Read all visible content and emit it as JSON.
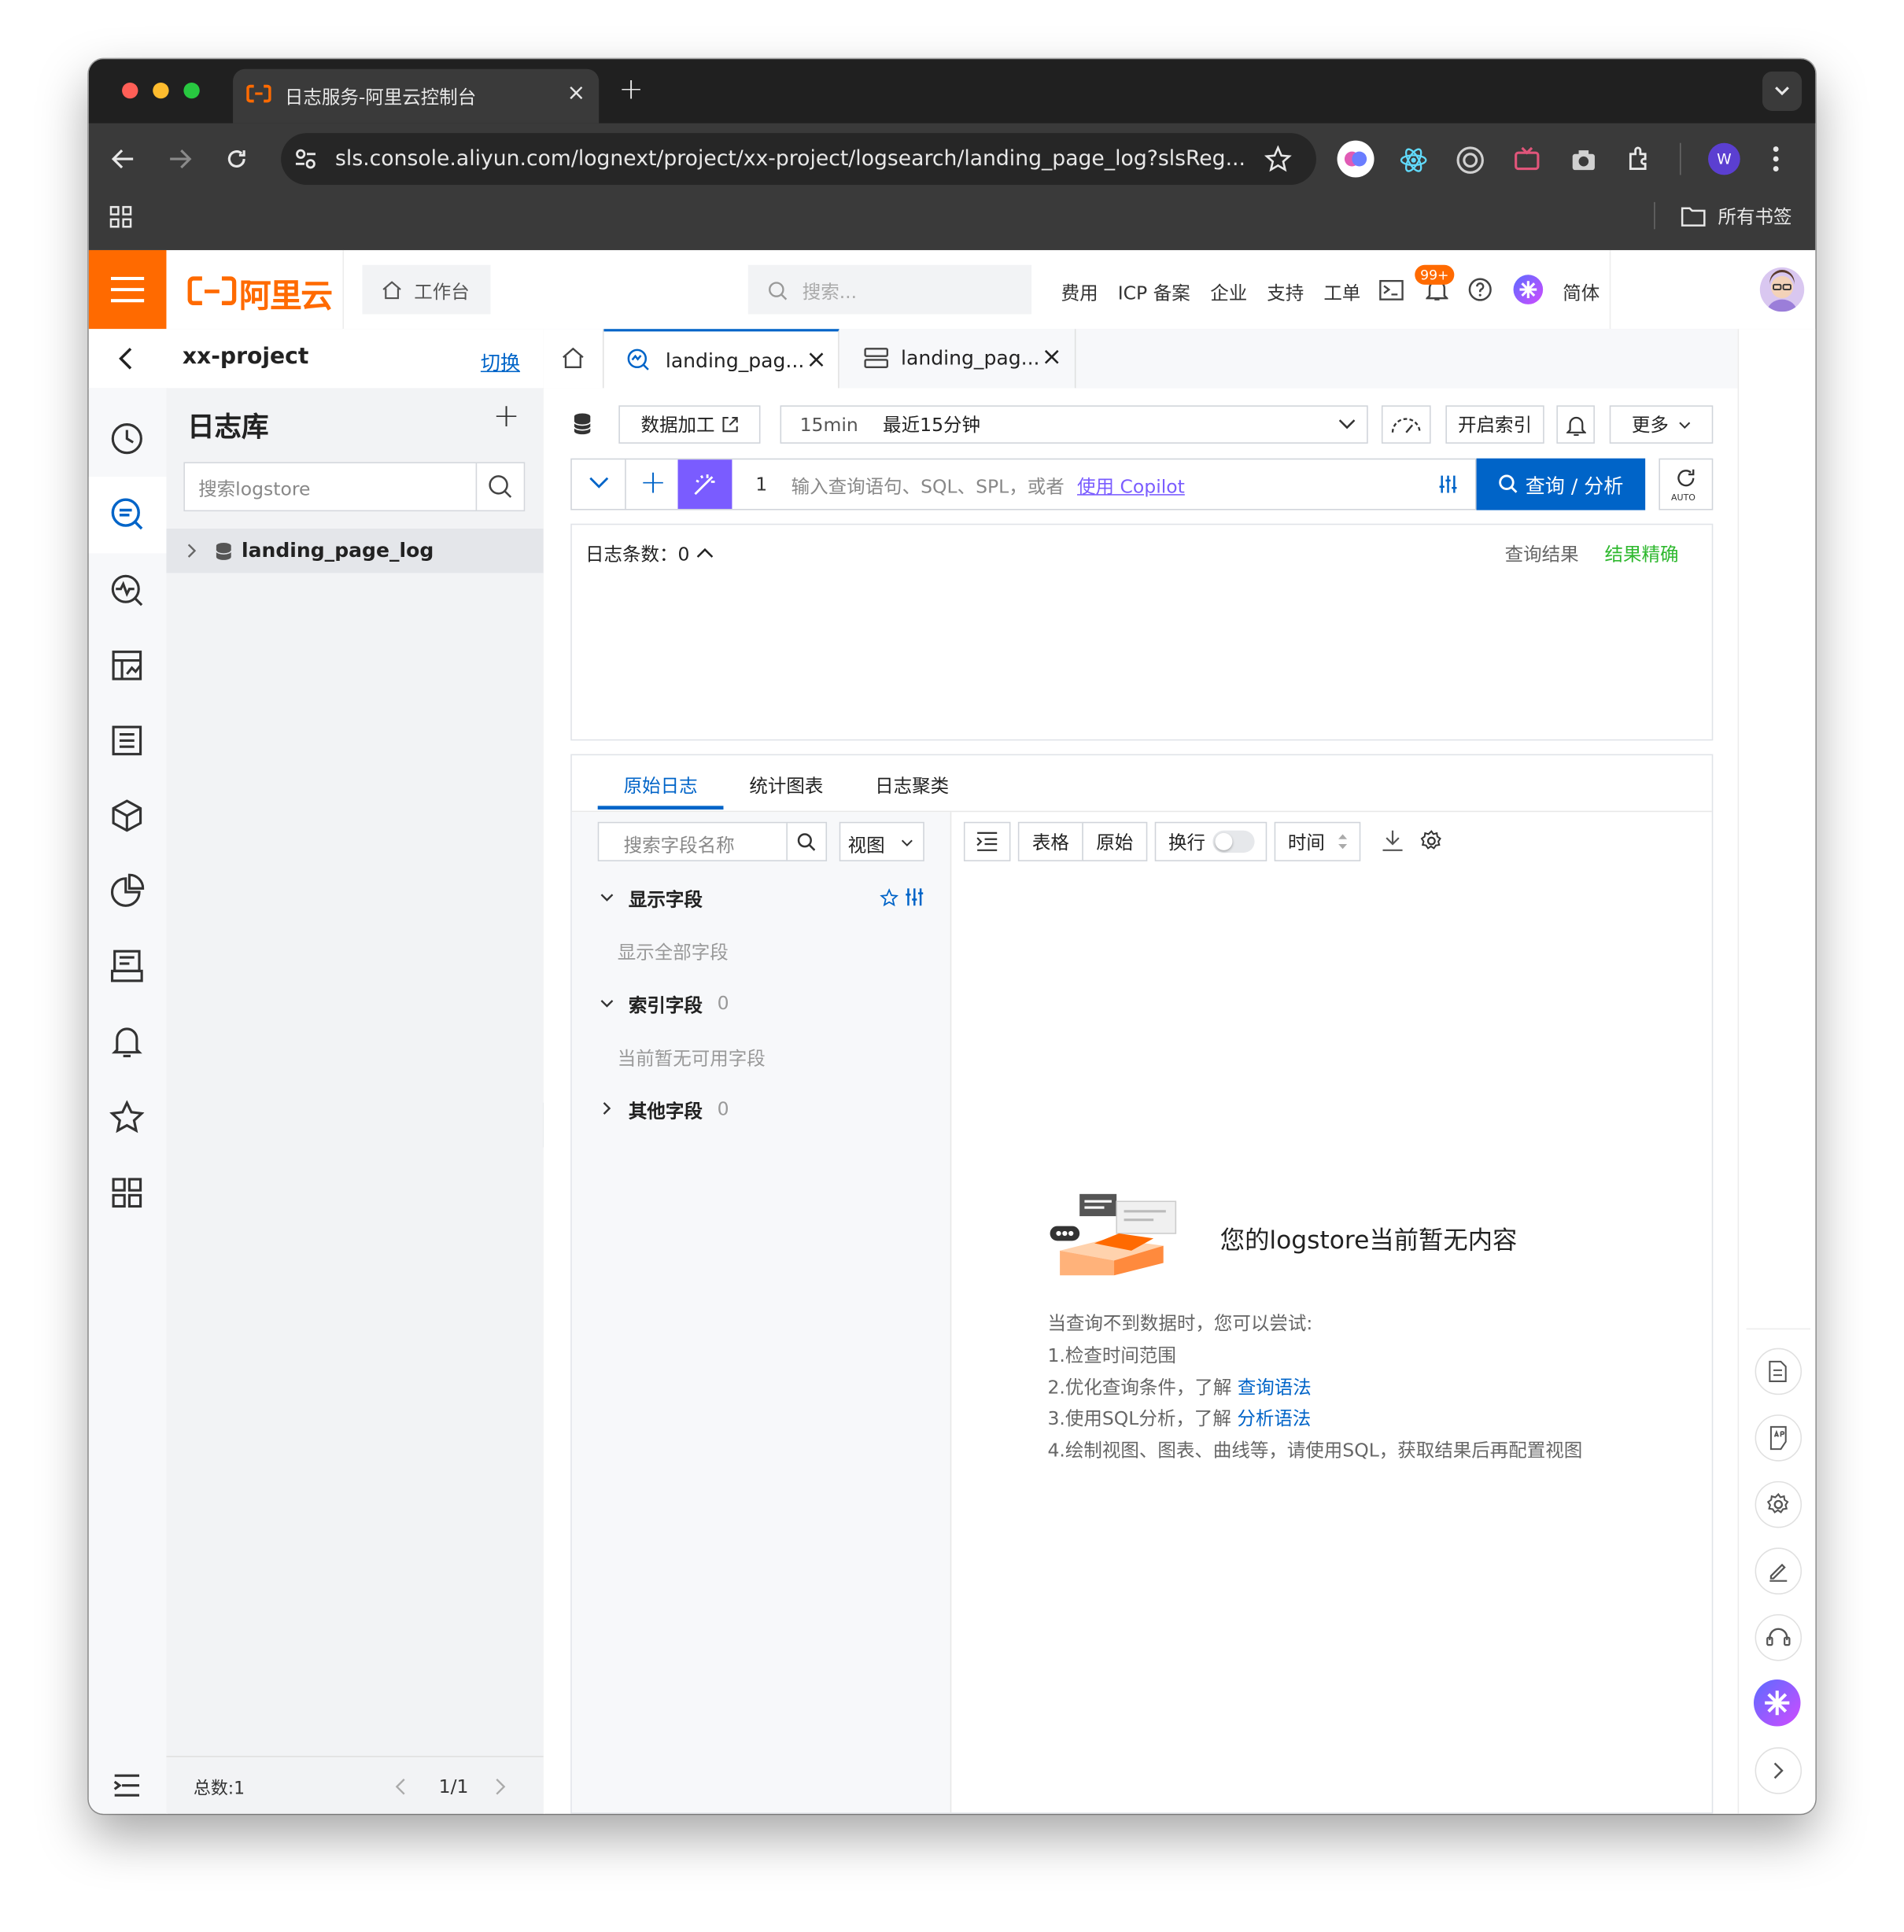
{
  "browser": {
    "tab1_title": "日志服务-阿里云控制台",
    "url": "sls.console.aliyun.com/lognext/project/xx-project/logsearch/landing_page_log?slsReg...",
    "bookmarks_label": "所有书签",
    "profile_initial": "W"
  },
  "topbar": {
    "brand": "阿里云",
    "workbench": "工作台",
    "search_placeholder": "搜索...",
    "links": [
      "费用",
      "ICP 备案",
      "企业",
      "支持",
      "工单"
    ],
    "badge": "99+",
    "lang": "简体"
  },
  "project": {
    "name": "xx-project",
    "switch": "切换"
  },
  "tabs": [
    {
      "label": "landing_pag..."
    },
    {
      "label": "landing_pag..."
    }
  ],
  "logstore_panel": {
    "title": "日志库",
    "search_placeholder": "搜索logstore",
    "item": "landing_page_log",
    "total": "总数:1",
    "page": "1/1"
  },
  "toolbar": {
    "data_process": "数据加工",
    "time_short": "15min",
    "time_label": "最近15分钟",
    "enable_index": "开启索引",
    "more": "更多"
  },
  "query": {
    "line_no": "1",
    "placeholder": "输入查询语句、SQL、SPL，或者",
    "copilot": "使用 Copilot",
    "search_btn": "查询 / 分析",
    "auto": "AUTO"
  },
  "histogram": {
    "count_label": "日志条数：0",
    "result_label": "查询结果",
    "result_status": "结果精确"
  },
  "result_tabs": [
    "原始日志",
    "统计图表",
    "日志聚类"
  ],
  "fields": {
    "search_placeholder": "搜索字段名称",
    "view": "视图",
    "display_fields": "显示字段",
    "show_all": "显示全部字段",
    "index_fields": "索引字段",
    "index_count": "0",
    "none_available": "当前暂无可用字段",
    "other_fields": "其他字段",
    "other_count": "0"
  },
  "log_toolbar": {
    "table": "表格",
    "raw": "原始",
    "wrap": "换行",
    "time": "时间"
  },
  "empty": {
    "title": "您的logstore当前暂无内容",
    "hint": "当查询不到数据时，您可以尝试:",
    "tip1": "1.检查时间范围",
    "tip2_prefix": "2.优化查询条件，了解",
    "tip2_link": "查询语法",
    "tip3_prefix": "3.使用SQL分析，了解",
    "tip3_link": "分析语法",
    "tip4": "4.绘制视图、图表、曲线等，请使用SQL，获取结果后再配置视图"
  },
  "colors": {
    "brand_orange": "#ff6a00",
    "primary_blue": "#0064c8",
    "success_green": "#2eb82e",
    "copilot_purple": "#7a5cff"
  }
}
